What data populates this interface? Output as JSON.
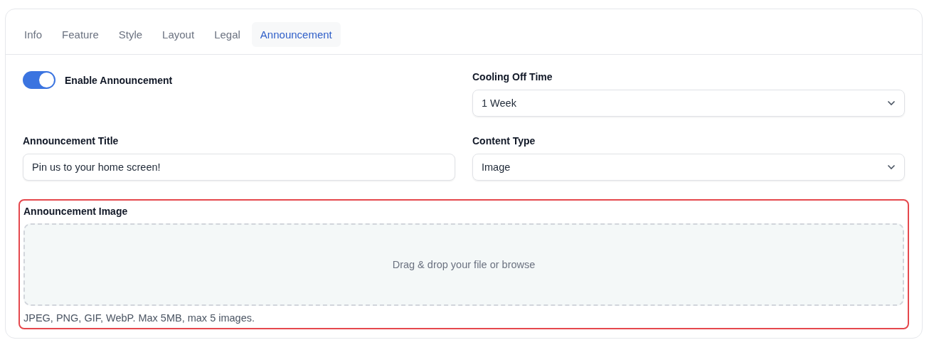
{
  "tabs": [
    {
      "label": "Info",
      "selected": false
    },
    {
      "label": "Feature",
      "selected": false
    },
    {
      "label": "Style",
      "selected": false
    },
    {
      "label": "Layout",
      "selected": false
    },
    {
      "label": "Legal",
      "selected": false
    },
    {
      "label": "Announcement",
      "selected": true
    }
  ],
  "enable_toggle": {
    "label": "Enable Announcement",
    "on": true
  },
  "cooling_off_time": {
    "label": "Cooling Off Time",
    "value": "1 Week"
  },
  "announcement_title": {
    "label": "Announcement Title",
    "value": "Pin us to your home screen!"
  },
  "content_type": {
    "label": "Content Type",
    "value": "Image"
  },
  "announcement_image": {
    "label": "Announcement Image",
    "highlighted": true,
    "dropzone_text": "Drag & drop your file or browse",
    "hint": "JPEG, PNG, GIF, WebP. Max 5MB, max 5 images."
  }
}
